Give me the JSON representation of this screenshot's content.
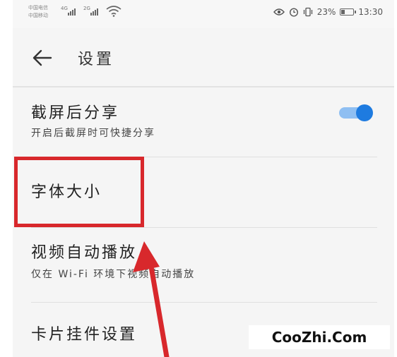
{
  "status_bar": {
    "carrier_1": "中国电信",
    "carrier_2": "中国移动",
    "net_1": "4G",
    "net_2": "2G",
    "battery": "23%",
    "time": "13:30",
    "icons": [
      "signal-icon",
      "wifi-icon",
      "eye-icon",
      "alarm-icon",
      "vibrate-icon",
      "battery-icon"
    ]
  },
  "header": {
    "title": "设置",
    "back_icon": "arrow-left-icon"
  },
  "settings": [
    {
      "title": "截屏后分享",
      "subtitle": "开启后截屏时可快捷分享",
      "toggle": true
    },
    {
      "title": "字体大小"
    },
    {
      "title": "视频自动播放",
      "subtitle": "仅在 Wi-Fi 环境下视频自动播放"
    },
    {
      "title": "卡片挂件设置"
    }
  ],
  "colors": {
    "highlight": "#d8282c",
    "toggle_on": "#1e7be0",
    "toggle_track": "#8fbff2"
  },
  "watermark": "CooZhi.Com"
}
